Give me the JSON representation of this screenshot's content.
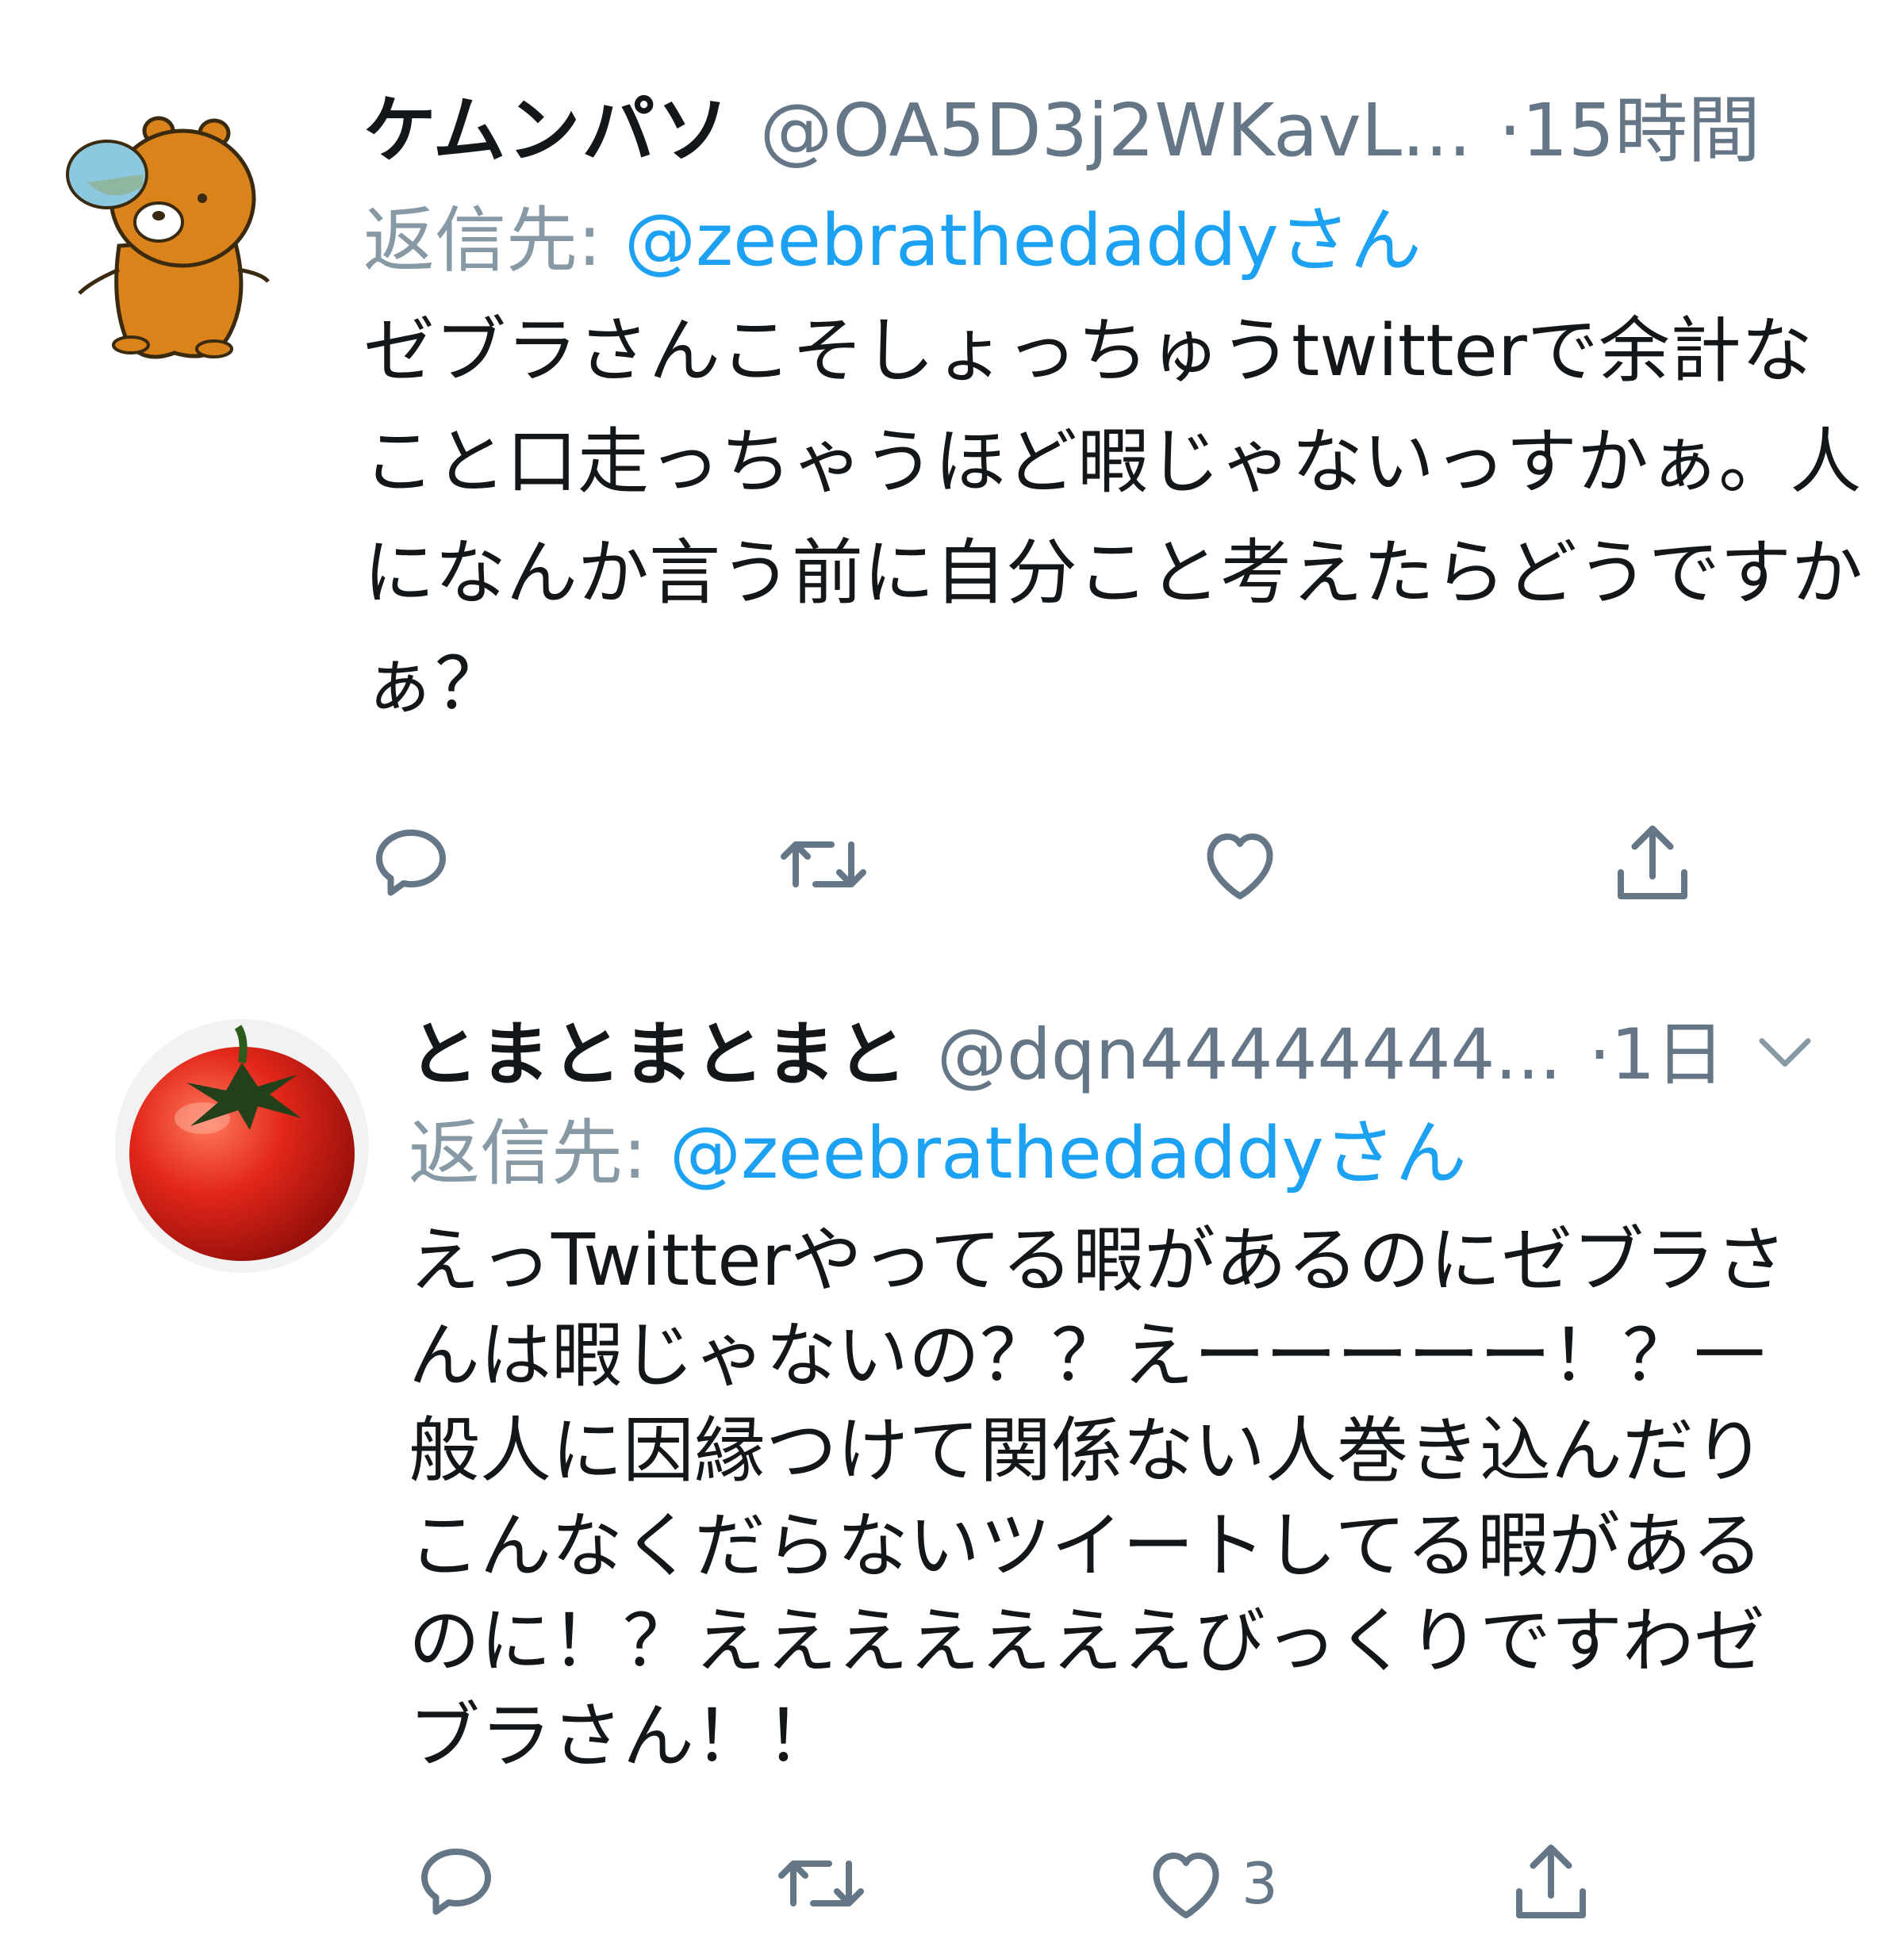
{
  "tweets": [
    {
      "display_name": "ケムンパソ",
      "handle": "@OA5D3j2WKavL...",
      "separator": "·",
      "time": "15時間",
      "reply_prefix": "返信先: ",
      "reply_to": "@zeebrathedaddyさん",
      "body": "ゼブラさんこそしょっちゅうtwitterで余計なこと口走っちゃうほど暇じゃないっすかぁ。人になんか言う前に自分こと考えたらどうですかぁ？",
      "avatar_icon": "bear-avatar-icon",
      "actions": [
        {
          "name": "reply",
          "icon": "reply-icon",
          "count": ""
        },
        {
          "name": "retweet",
          "icon": "retweet-icon",
          "count": ""
        },
        {
          "name": "like",
          "icon": "heart-icon",
          "count": ""
        },
        {
          "name": "share",
          "icon": "share-icon",
          "count": ""
        }
      ]
    },
    {
      "display_name": "とまとまとまと",
      "handle": "@dqn44444444...",
      "separator": "·",
      "time": "1日",
      "reply_prefix": "返信先: ",
      "reply_to": "@zeebrathedaddyさん",
      "body": "えっTwitterやってる暇があるのにゼブラさんは暇じゃないの？？えーーーーー！？一般人に因縁つけて関係ない人巻き込んだりこんなくだらないツイートしてる暇があるのに！？えええええええびっくりですわゼブラさん！！",
      "avatar_icon": "tomato-avatar-icon",
      "actions": [
        {
          "name": "reply",
          "icon": "reply-icon",
          "count": ""
        },
        {
          "name": "retweet",
          "icon": "retweet-icon",
          "count": ""
        },
        {
          "name": "like",
          "icon": "heart-icon",
          "count": "3"
        },
        {
          "name": "share",
          "icon": "share-icon",
          "count": ""
        }
      ]
    }
  ],
  "colors": {
    "link": "#1da1f2",
    "secondary_text": "#657786",
    "primary_text": "#14171a",
    "icon": "#657786"
  }
}
